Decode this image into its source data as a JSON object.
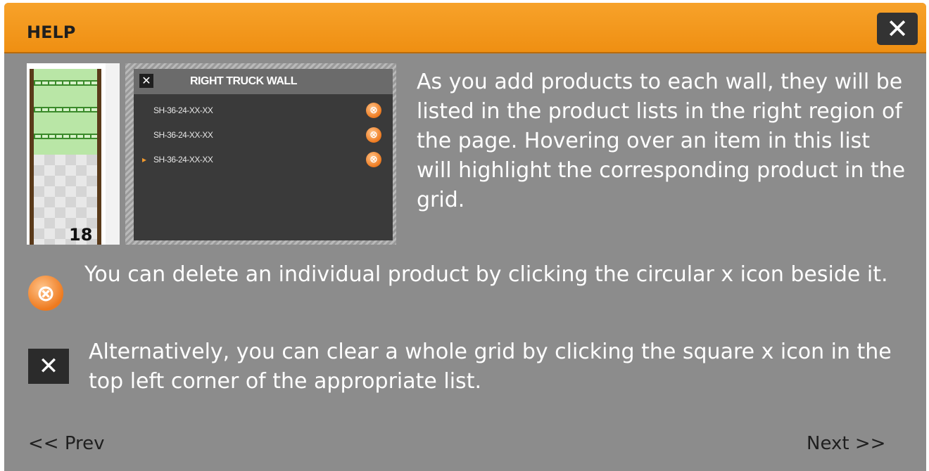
{
  "dialog": {
    "title": "HELP",
    "close_icon": "close-icon"
  },
  "preview": {
    "grid_number": "18",
    "list_title": "RIGHT TRUCK WALL",
    "items": [
      {
        "code": "SH-36-24-XX-XX",
        "selected": false
      },
      {
        "code": "SH-36-24-XX-XX",
        "selected": false
      },
      {
        "code": "SH-36-24-XX-XX",
        "selected": true
      }
    ],
    "selected_marker": "▸",
    "delete_glyph": "⊗"
  },
  "paragraphs": {
    "list_info": "As you add products to each wall, they will be listed in the product lists in the right region of the page. Hovering over an item in this list will highlight the corresponding product in the grid.",
    "delete_info": "You can delete an individual product by clicking the circular x icon beside it.",
    "clear_info": "Alternatively, you can clear a whole grid by clicking the square x icon in the top left corner of the appropriate list."
  },
  "nav": {
    "prev": "<< Prev",
    "next": "Next >>"
  },
  "colors": {
    "titlebar": "#f29a1f",
    "panel": "#8c8c8c",
    "accent": "#ee7a1f"
  }
}
